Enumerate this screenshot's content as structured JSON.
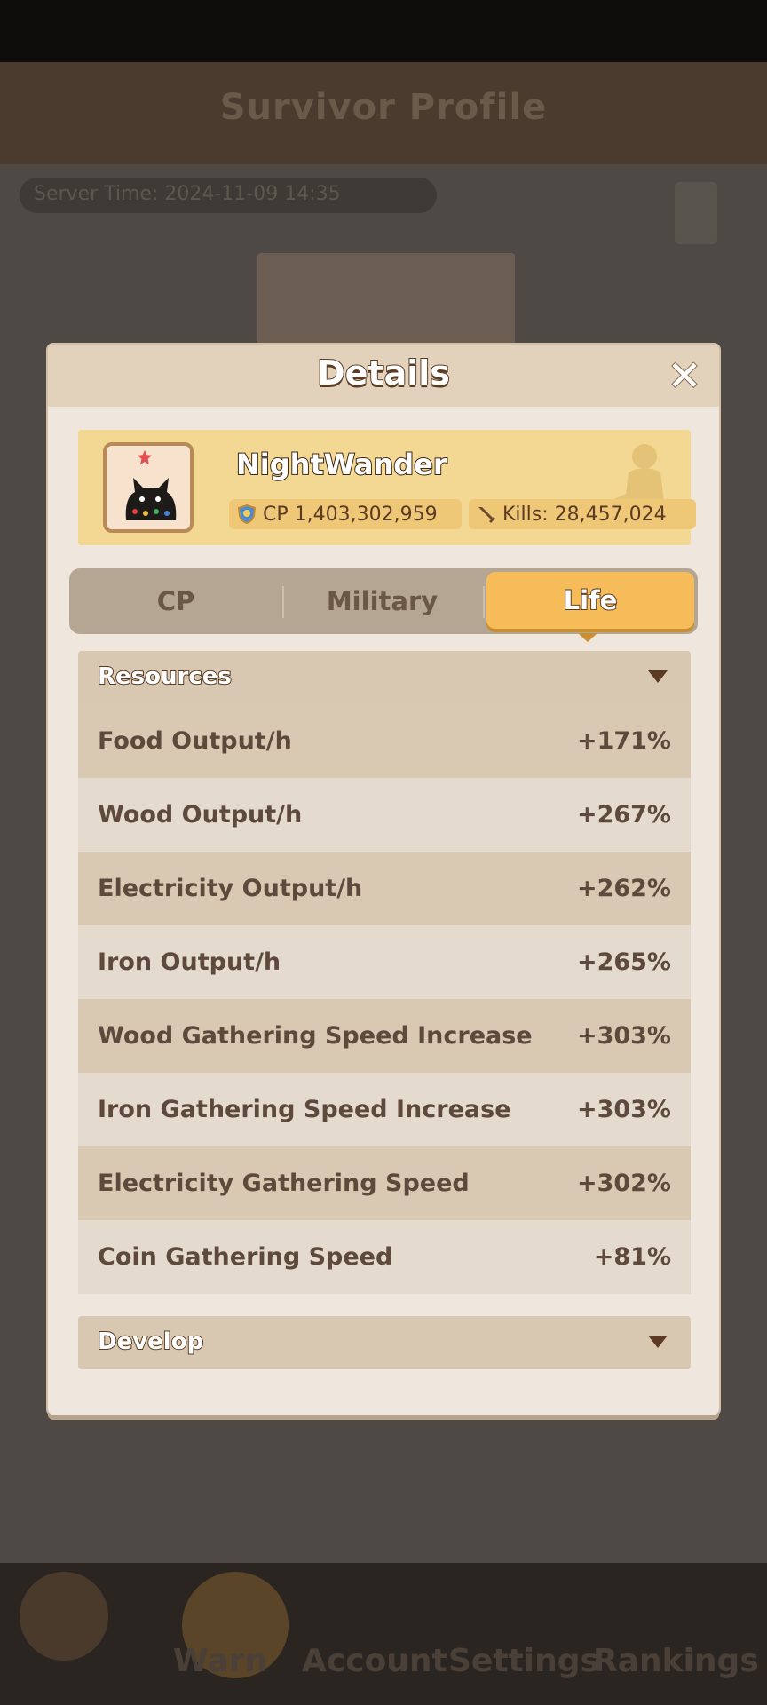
{
  "background": {
    "header_title": "Survivor Profile",
    "time_text": "Server Time: 2024-11-09 14:35",
    "nav_labels": [
      "Warn",
      "Account",
      "Settings",
      "Rankings"
    ]
  },
  "dialog": {
    "title": "Details",
    "close_icon": "close-icon"
  },
  "profile": {
    "username": "NightWander",
    "cp_label": "CP",
    "cp_value": "1,403,302,959",
    "kills_label": "Kills:",
    "kills_value": "28,457,024"
  },
  "tabs": [
    {
      "label": "CP",
      "active": false
    },
    {
      "label": "Military",
      "active": false
    },
    {
      "label": "Life",
      "active": true
    }
  ],
  "sections": {
    "resources": {
      "title": "Resources",
      "rows": [
        {
          "label": "Food Output/h",
          "value": "+171%"
        },
        {
          "label": "Wood Output/h",
          "value": "+267%"
        },
        {
          "label": "Electricity Output/h",
          "value": "+262%"
        },
        {
          "label": "Iron Output/h",
          "value": "+265%"
        },
        {
          "label": "Wood Gathering Speed Increase",
          "value": "+303%"
        },
        {
          "label": "Iron Gathering Speed Increase",
          "value": "+303%"
        },
        {
          "label": "Electricity Gathering Speed",
          "value": "+302%"
        },
        {
          "label": "Coin Gathering Speed",
          "value": "+81%"
        }
      ]
    },
    "develop": {
      "title": "Develop"
    }
  },
  "colors": {
    "accent": "#f6bc5a",
    "panel": "#efe7dd",
    "text_dark": "#5e4a3c"
  }
}
